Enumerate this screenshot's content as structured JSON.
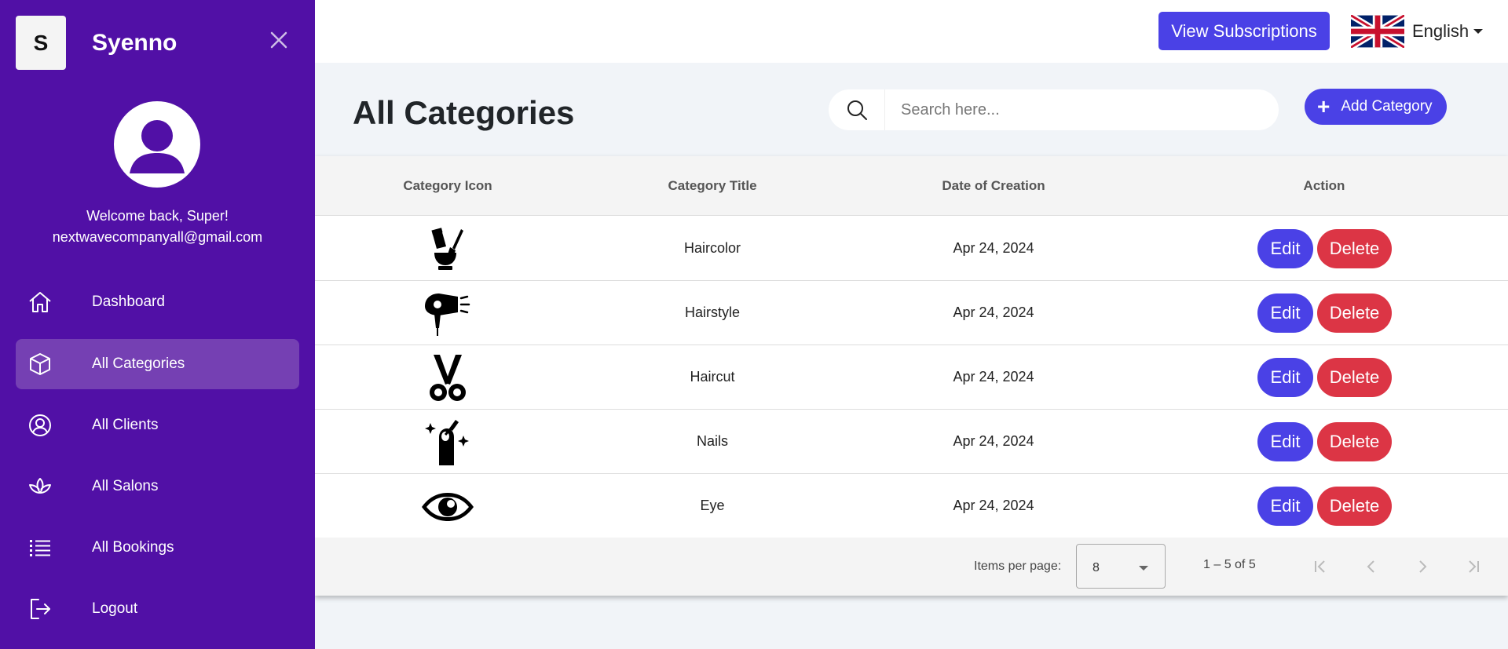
{
  "sidebar": {
    "logo_letter": "S",
    "brand": "Syenno",
    "welcome": "Welcome back, Super!",
    "email": "nextwavecompanyall@gmail.com",
    "items": [
      {
        "label": "Dashboard",
        "icon": "home-icon"
      },
      {
        "label": "All Categories",
        "icon": "cube-icon",
        "active": true
      },
      {
        "label": "All Clients",
        "icon": "user-circle-icon"
      },
      {
        "label": "All Salons",
        "icon": "lotus-icon"
      },
      {
        "label": "All Bookings",
        "icon": "list-icon"
      },
      {
        "label": "Logout",
        "icon": "logout-icon"
      }
    ]
  },
  "topbar": {
    "subscriptions_label": "View Subscriptions",
    "language": "English",
    "language_flag": "uk-flag-icon"
  },
  "page": {
    "title": "All Categories",
    "search_placeholder": "Search here...",
    "add_label": "Add Category"
  },
  "table": {
    "columns": [
      "Category Icon",
      "Category Title",
      "Date of Creation",
      "Action"
    ],
    "rows": [
      {
        "icon": "haircolor-icon",
        "title": "Haircolor",
        "date": "Apr 24, 2024",
        "edit": "Edit",
        "delete": "Delete"
      },
      {
        "icon": "hairdryer-icon",
        "title": "Hairstyle",
        "date": "Apr 24, 2024",
        "edit": "Edit",
        "delete": "Delete"
      },
      {
        "icon": "scissors-icon",
        "title": "Haircut",
        "date": "Apr 24, 2024",
        "edit": "Edit",
        "delete": "Delete"
      },
      {
        "icon": "nail-polish-icon",
        "title": "Nails",
        "date": "Apr 24, 2024",
        "edit": "Edit",
        "delete": "Delete"
      },
      {
        "icon": "eye-icon",
        "title": "Eye",
        "date": "Apr 24, 2024",
        "edit": "Edit",
        "delete": "Delete"
      }
    ]
  },
  "paginator": {
    "items_per_page_label": "Items per page:",
    "items_per_page": "8",
    "range": "1 – 5 of 5"
  },
  "colors": {
    "sidebar": "#5110a6",
    "primary": "#4a41e6",
    "danger": "#dc3545"
  }
}
